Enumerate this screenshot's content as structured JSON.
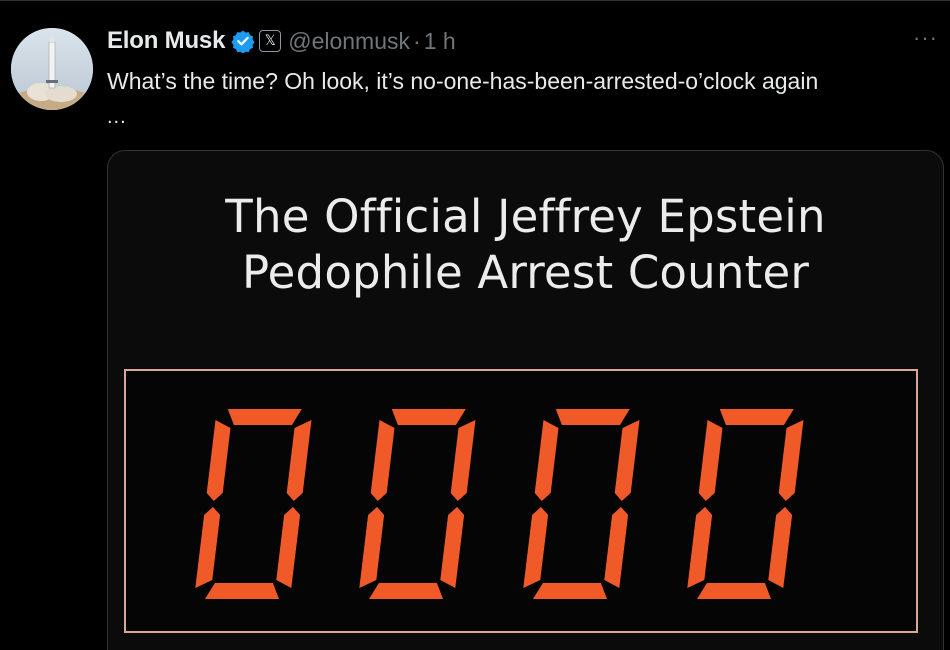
{
  "tweet": {
    "author": {
      "name": "Elon Musk",
      "handle": "@elonmusk",
      "verified_icon": "verified-badge-icon",
      "affiliate_icon": "x-logo-icon",
      "affiliate_glyph": "𝕏"
    },
    "separator": "·",
    "time": "1 h",
    "more_label": "···",
    "text_line1": "What’s the time? Oh look, it’s no-one-has-been-arrested-o’clock again",
    "text_line2": "..."
  },
  "media": {
    "title_line1": "The Official Jeffrey Epstein",
    "title_line2": "Pedophile Arrest Counter",
    "counter_value": "0000",
    "digit_color": "#f05a28",
    "frame_color": "#d8a894"
  },
  "colors": {
    "background": "#000000",
    "text_primary": "#e7e9ea",
    "text_secondary": "#71767b",
    "verified_blue": "#1d9bf0"
  }
}
